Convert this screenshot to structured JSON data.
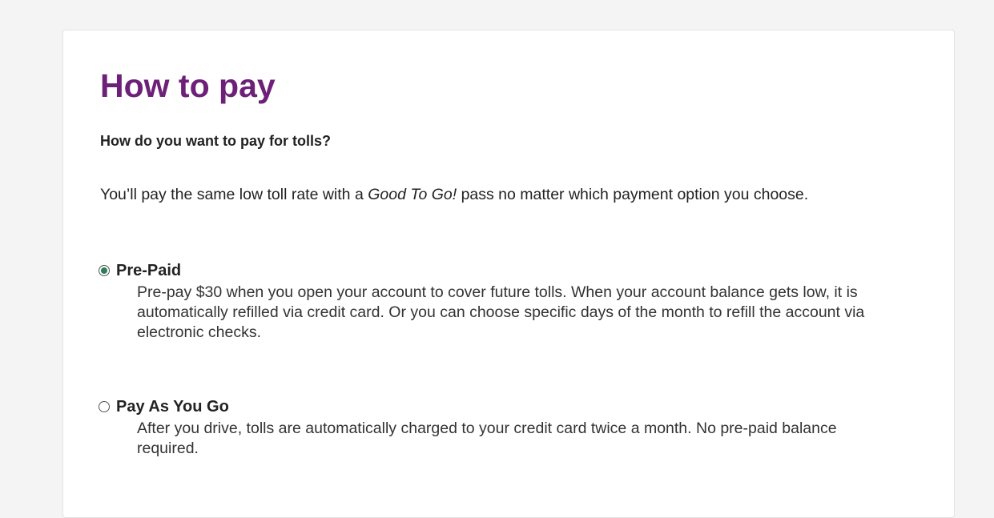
{
  "colors": {
    "title": "#6c2077",
    "radio_checked": "#2e7d5b",
    "page_bg": "#f4f4f4",
    "card_bg": "#ffffff"
  },
  "section": {
    "title": "How to pay",
    "question": "How do you want to pay for tolls?",
    "intro_before": "You’ll pay the same low toll rate with a ",
    "intro_emphasis": "Good To Go!",
    "intro_after": " pass no matter which payment option you choose."
  },
  "options": [
    {
      "label": "Pre-Paid",
      "selected": true,
      "description": "Pre-pay $30 when you open your account to cover future tolls. When your account balance gets low, it is automatically refilled via credit card. Or you can choose specific days of the month to refill the account via electronic checks."
    },
    {
      "label": "Pay As You Go",
      "selected": false,
      "description": "After you drive, tolls are automatically charged to your credit card twice a month. No pre-paid balance required."
    }
  ]
}
